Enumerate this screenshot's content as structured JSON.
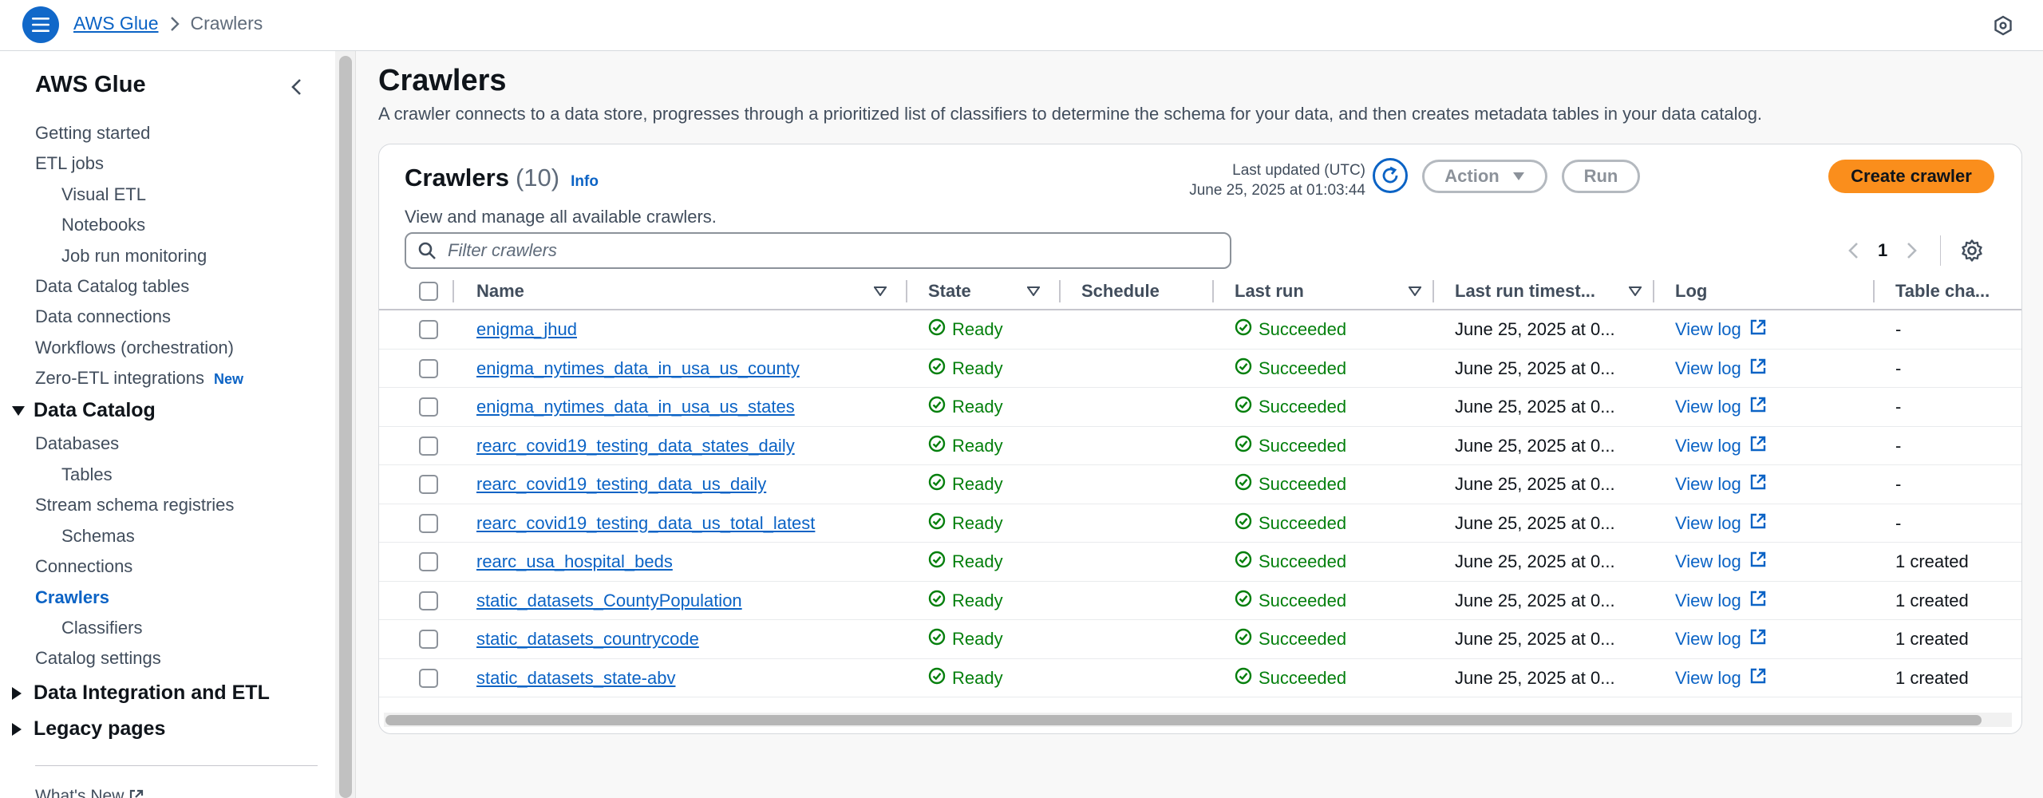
{
  "topbar": {
    "breadcrumb_root": "AWS Glue",
    "breadcrumb_current": "Crawlers"
  },
  "sidebar": {
    "title": "AWS Glue",
    "items": [
      {
        "label": "Getting started"
      },
      {
        "label": "ETL jobs"
      },
      {
        "label": "Visual ETL"
      },
      {
        "label": "Notebooks"
      },
      {
        "label": "Job run monitoring"
      },
      {
        "label": "Data Catalog tables"
      },
      {
        "label": "Data connections"
      },
      {
        "label": "Workflows (orchestration)"
      },
      {
        "label": "Zero-ETL integrations",
        "badge": "New"
      }
    ],
    "data_catalog": {
      "label": "Data Catalog",
      "items": [
        {
          "label": "Databases"
        },
        {
          "label": "Tables"
        },
        {
          "label": "Stream schema registries"
        },
        {
          "label": "Schemas"
        },
        {
          "label": "Connections"
        },
        {
          "label": "Crawlers"
        },
        {
          "label": "Classifiers"
        },
        {
          "label": "Catalog settings"
        }
      ]
    },
    "sections": [
      {
        "label": "Data Integration and ETL"
      },
      {
        "label": "Legacy pages"
      }
    ],
    "whats_new": "What's New"
  },
  "main": {
    "title": "Crawlers",
    "description": "A crawler connects to a data store, progresses through a prioritized list of classifiers to determine the schema for your data, and then creates metadata tables in your data catalog."
  },
  "panel": {
    "title": "Crawlers",
    "count": "(10)",
    "info": "Info",
    "subtitle": "View and manage all available crawlers.",
    "last_updated_label": "Last updated (UTC)",
    "last_updated_value": "June 25, 2025 at 01:03:44",
    "action_label": "Action",
    "run_label": "Run",
    "create_label": "Create crawler",
    "filter_placeholder": "Filter crawlers",
    "page": "1"
  },
  "table": {
    "headers": {
      "name": "Name",
      "state": "State",
      "schedule": "Schedule",
      "last_run": "Last run",
      "last_run_ts": "Last run timest...",
      "log": "Log",
      "table_changes": "Table cha..."
    },
    "rows": [
      {
        "name": "enigma_jhud",
        "state": "Ready",
        "schedule": "",
        "last_run": "Succeeded",
        "ts": "June 25, 2025 at 0...",
        "log": "View log",
        "changes": "-"
      },
      {
        "name": "enigma_nytimes_data_in_usa_us_county",
        "state": "Ready",
        "schedule": "",
        "last_run": "Succeeded",
        "ts": "June 25, 2025 at 0...",
        "log": "View log",
        "changes": "-"
      },
      {
        "name": "enigma_nytimes_data_in_usa_us_states",
        "state": "Ready",
        "schedule": "",
        "last_run": "Succeeded",
        "ts": "June 25, 2025 at 0...",
        "log": "View log",
        "changes": "-"
      },
      {
        "name": "rearc_covid19_testing_data_states_daily",
        "state": "Ready",
        "schedule": "",
        "last_run": "Succeeded",
        "ts": "June 25, 2025 at 0...",
        "log": "View log",
        "changes": "-"
      },
      {
        "name": "rearc_covid19_testing_data_us_daily",
        "state": "Ready",
        "schedule": "",
        "last_run": "Succeeded",
        "ts": "June 25, 2025 at 0...",
        "log": "View log",
        "changes": "-"
      },
      {
        "name": "rearc_covid19_testing_data_us_total_latest",
        "state": "Ready",
        "schedule": "",
        "last_run": "Succeeded",
        "ts": "June 25, 2025 at 0...",
        "log": "View log",
        "changes": "-"
      },
      {
        "name": "rearc_usa_hospital_beds",
        "state": "Ready",
        "schedule": "",
        "last_run": "Succeeded",
        "ts": "June 25, 2025 at 0...",
        "log": "View log",
        "changes": "1 created"
      },
      {
        "name": "static_datasets_CountyPopulation",
        "state": "Ready",
        "schedule": "",
        "last_run": "Succeeded",
        "ts": "June 25, 2025 at 0...",
        "log": "View log",
        "changes": "1 created"
      },
      {
        "name": "static_datasets_countrycode",
        "state": "Ready",
        "schedule": "",
        "last_run": "Succeeded",
        "ts": "June 25, 2025 at 0...",
        "log": "View log",
        "changes": "1 created"
      },
      {
        "name": "static_datasets_state-abv",
        "state": "Ready",
        "schedule": "",
        "last_run": "Succeeded",
        "ts": "June 25, 2025 at 0...",
        "log": "View log",
        "changes": "1 created"
      }
    ]
  },
  "colors": {
    "link": "#0b63c5",
    "success": "#037f0c",
    "primary_button": "#fa8e1c"
  }
}
